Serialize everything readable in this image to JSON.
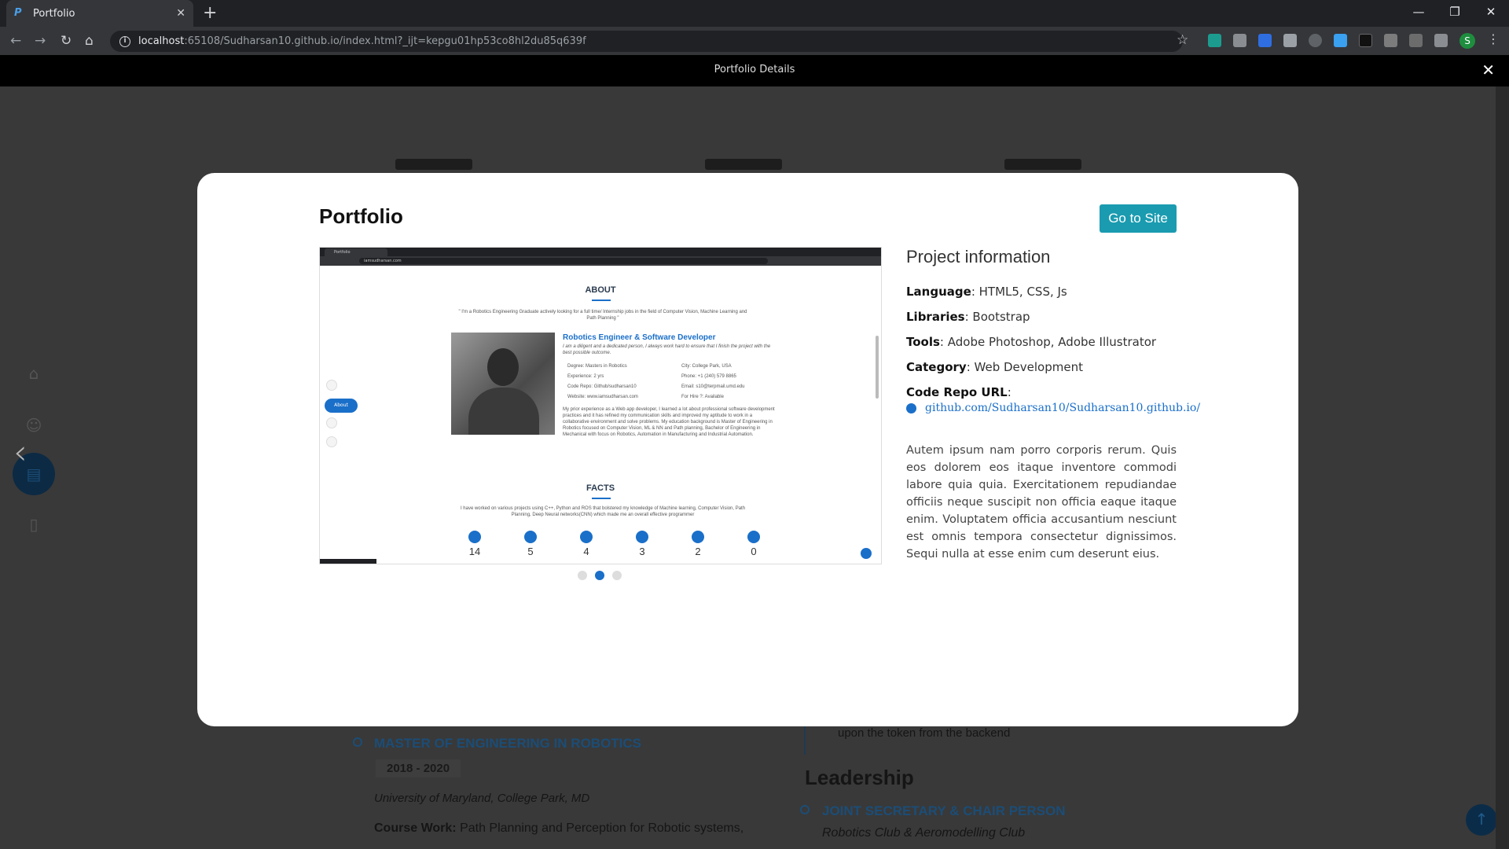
{
  "browser": {
    "tab_title": "Portfolio",
    "url_host": "localhost",
    "url_path": ":65108/Sudharsan10.github.io/index.html?_ijt=kepgu01hp53co8hl2du85q639f",
    "profile_initial": "S"
  },
  "lightbox": {
    "title": "Portfolio Details",
    "close": "✕"
  },
  "background": {
    "degree": "MASTER OF ENGINEERING IN ROBOTICS",
    "years": "2018 - 2020",
    "school": "University of Maryland, College Park, MD",
    "coursework_label": "Course Work:",
    "coursework": "Path Planning and Perception for Robotic systems,",
    "token_text": "upon the token from the backend",
    "leadership": "Leadership",
    "role": "JOINT SECRETARY & CHAIR PERSON",
    "club": "Robotics Club & Aeromodelling Club"
  },
  "modal": {
    "title": "Portfolio",
    "go_to_site": "Go to Site",
    "project_info_title": "Project information",
    "info": [
      {
        "label": "Language",
        "value": ": HTML5, CSS, Js"
      },
      {
        "label": "Libraries",
        "value": ": Bootstrap"
      },
      {
        "label": "Tools",
        "value": ": Adobe Photoshop, Adobe Illustrator"
      },
      {
        "label": "Category",
        "value": ": Web Development"
      },
      {
        "label": "Code Repo URL",
        "value": ":"
      }
    ],
    "repo_link": "github.com/Sudharsan10/Sudharsan10.github.io/",
    "description": "Autem ipsum nam porro corporis rerum. Quis eos dolorem eos itaque inventore commodi labore quia quia. Exercitationem repudiandae officiis neque suscipit non officia eaque itaque enim. Voluptatem officia accusantium nesciunt est omnis tempora consectetur dignissimos. Sequi nulla at esse enim cum deserunt eius.",
    "slide_count": 3,
    "active_slide": 2
  },
  "screenshot": {
    "tab": "Portfolio",
    "url": "iamsudharsan.com",
    "about_heading": "ABOUT",
    "quote": "\" I'm a Robotics Engineering Graduate actively looking for a full time/ Internship jobs in the field of Computer Vision, Machine Learning and Path Planning \"",
    "role_title": "Robotics Engineer & Software Developer",
    "role_sub": "I am a diligent and a dedicated person, I always work hard to ensure that I finish the project with the best possible outcome.",
    "degree": "Degree: Masters in Robotics",
    "experience": "Experience: 2 yrs",
    "code_repo": "Code Repo: Github/sudharsan10",
    "website": "Website: www.iamsudharsan.com",
    "city": "City: College Park, USA",
    "phone": "Phone: +1 (240) 579 8865",
    "email": "Email: s10@terpmail.umd.edu",
    "hire": "For Hire ?: Available",
    "bio": "My prior experience as a Web app developer, I learned a lot about professional software development practices and it has refined my communication skills and improved my aptitude to work in a collaborative environment and solve problems. My education background is Master of Engineering in Robotics focused on Computer Vision, ML & NN and Path planning, Bachelor of Engineering in Mechanical with focus on Robotics, Automation in Manufacturing and Industrial Automation.",
    "about_pill": "About",
    "facts_heading": "FACTS",
    "facts_text": "I have worked on various projects using C++, Python and ROS that bolstered my knowledge of Machine learning, Computer Vision, Path Planning, Deep Neural networks(CNN) which made me an overall effective programmer",
    "facts": [
      "14",
      "5",
      "4",
      "3",
      "2",
      "0"
    ]
  },
  "colors": {
    "accent": "#1a9bb0",
    "link": "#1a6fc9"
  }
}
